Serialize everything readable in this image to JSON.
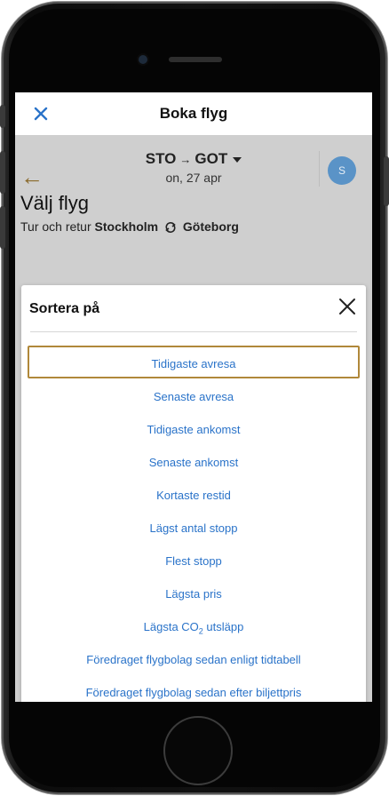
{
  "topbar": {
    "title": "Boka flyg"
  },
  "header": {
    "origin": "STO",
    "destination": "GOT",
    "date": "on, 27 apr",
    "avatar_initial": "S",
    "page_title": "Välj flyg",
    "trip_type": "Tur och retur",
    "from_city": "Stockholm",
    "to_city": "Göteborg"
  },
  "sort_modal": {
    "title": "Sortera på",
    "options": [
      {
        "label": "Tidigaste avresa",
        "selected": true
      },
      {
        "label": "Senaste avresa"
      },
      {
        "label": "Tidigaste ankomst"
      },
      {
        "label": "Senaste ankomst"
      },
      {
        "label": "Kortaste restid"
      },
      {
        "label": "Lägst antal stopp"
      },
      {
        "label": "Flest stopp"
      },
      {
        "label": "Lägsta pris"
      },
      {
        "label_prefix": "Lägsta CO",
        "label_sub": "2",
        "label_suffix": " utsläpp"
      },
      {
        "label": "Föredraget flygbolag sedan enligt tidtabell"
      },
      {
        "label": "Föredraget flygbolag sedan efter biljettpris"
      }
    ]
  },
  "colors": {
    "accent_gold": "#b0883a",
    "link_blue": "#2a73c9",
    "avatar_blue": "#5a93c7"
  },
  "icons": [
    "close-icon",
    "back-arrow-icon",
    "dropdown-caret-icon",
    "swap-icon"
  ]
}
